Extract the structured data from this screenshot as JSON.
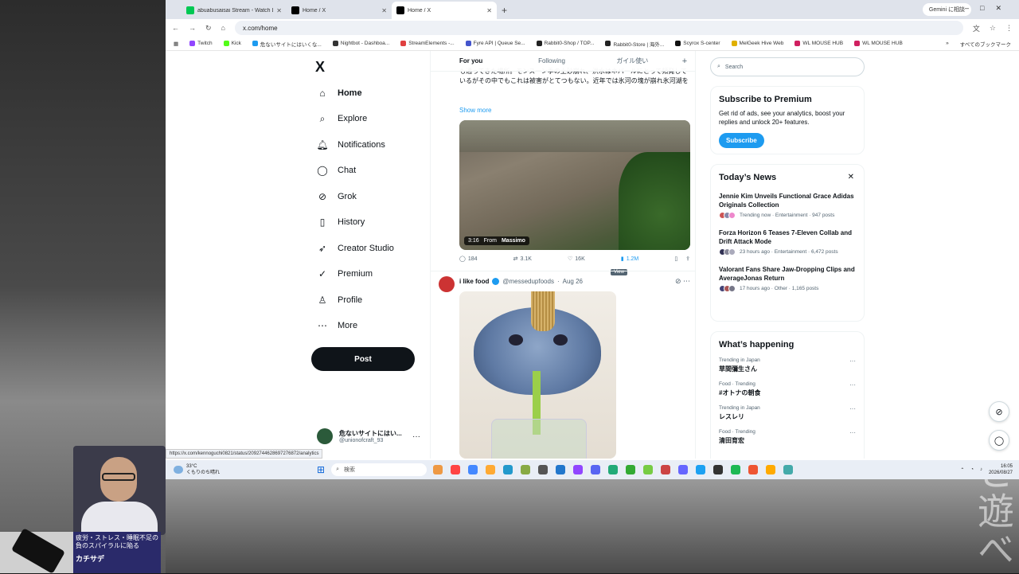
{
  "browser": {
    "tabs": [
      {
        "title": "abuabusaisai Stream - Watch L",
        "color": "#00c853"
      },
      {
        "title": "Home / X",
        "color": "#000000"
      },
      {
        "title": "Home / X",
        "color": "#000000"
      }
    ],
    "new_tab": "+",
    "gemini_button": "Gemini に相談",
    "url": "x.com/home",
    "bookmarks": [
      {
        "label": "Twitch",
        "color": "#9146ff"
      },
      {
        "label": "Kick",
        "color": "#53fc18"
      },
      {
        "label": "危ないサイトにはいくな...",
        "color": "#1d9bf0"
      },
      {
        "label": "Nightbot - Dashboa...",
        "color": "#333333"
      },
      {
        "label": "StreamElements -...",
        "color": "#e04040"
      },
      {
        "label": "Fyre API | Queue Se...",
        "color": "#4455cc"
      },
      {
        "label": "Rabbit0-Shop / TOP...",
        "color": "#222222"
      },
      {
        "label": "Rabbit0-Store | 海外...",
        "color": "#222222"
      },
      {
        "label": "Scyrox S-center",
        "color": "#111111"
      },
      {
        "label": "MelGeek Hive Web",
        "color": "#e0b000"
      },
      {
        "label": "WL MOUSE HUB",
        "color": "#d02060"
      },
      {
        "label": "WL MOUSE HUB",
        "color": "#d02060"
      }
    ],
    "bookmarks_more": "»",
    "all_bookmarks": "すべてのブックマーク",
    "status_url": "https://x.com/kennoguchi0821/status/2092744628697276872/analytics"
  },
  "nav": {
    "logo": "X",
    "items": [
      {
        "label": "Home",
        "icon": "home-icon",
        "glyph": "⌂"
      },
      {
        "label": "Explore",
        "icon": "search-icon",
        "glyph": "⌕"
      },
      {
        "label": "Notifications",
        "icon": "bell-icon",
        "glyph": "🔔︎"
      },
      {
        "label": "Chat",
        "icon": "chat-icon",
        "glyph": "◯"
      },
      {
        "label": "Grok",
        "icon": "grok-icon",
        "glyph": "⊘"
      },
      {
        "label": "History",
        "icon": "bookmark-icon",
        "glyph": "▯"
      },
      {
        "label": "Creator Studio",
        "icon": "rocket-icon",
        "glyph": "➶"
      },
      {
        "label": "Premium",
        "icon": "premium-icon",
        "glyph": "✓"
      },
      {
        "label": "Profile",
        "icon": "person-icon",
        "glyph": "♙"
      },
      {
        "label": "More",
        "icon": "more-circle-icon",
        "glyph": "⋯"
      }
    ],
    "post_button": "Post",
    "account": {
      "name": "危ないサイトにはい...",
      "handle": "@unionofcraft_93",
      "more": "···"
    }
  },
  "feed": {
    "tabs": [
      "For you",
      "Following",
      "ガイル使い"
    ],
    "add_tab": "+",
    "tweet1": {
      "text": "も通ってきた場所。モンスーン季の土砂崩れ、洪水はネパールにとって頻発しているがその中でもこれは被害がとてつもない。近年では氷河の塊が崩れ氷河湖を",
      "show_more": "Show more",
      "video_time": "3:16",
      "video_from": "From",
      "video_source": "Massimo",
      "replies": "184",
      "reposts": "3.1K",
      "likes": "16K",
      "views": "1.2M",
      "view_tooltip": "View"
    },
    "tweet2": {
      "name": "i like food",
      "handle": "@messedupfoods",
      "date": "Aug 26"
    }
  },
  "sidebar": {
    "search_placeholder": "Search",
    "premium": {
      "title": "Subscribe to Premium",
      "body": "Get rid of ads, see your analytics, boost your replies and unlock 20+ features.",
      "button": "Subscribe"
    },
    "news": {
      "title": "Today’s News",
      "close": "✕",
      "items": [
        {
          "title": "Jennie Kim Unveils Functional Grace Adidas Originals Collection",
          "meta": "Trending now · Entertainment · 947 posts"
        },
        {
          "title": "Forza Horizon 6 Teases 7-Eleven Collab and Drift Attack Mode",
          "meta": "23 hours ago · Entertainment · 6,472 posts"
        },
        {
          "title": "Valorant Fans Share Jaw-Dropping Clips and AverageJonas Return",
          "meta": "17 hours ago · Other · 1,165 posts"
        }
      ]
    },
    "happening": {
      "title": "What’s happening",
      "items": [
        {
          "context": "Trending in Japan",
          "topic": "草間彌生さん"
        },
        {
          "context": "Food · Trending",
          "topic": "#オトナの朝食"
        },
        {
          "context": "Trending in Japan",
          "topic": "レスレリ"
        },
        {
          "context": "Food · Trending",
          "topic": "清田育宏"
        }
      ]
    }
  },
  "taskbar": {
    "temp": "33°C",
    "weather": "くもりのち晴れ",
    "search": "検索",
    "time": "16:05",
    "date": "2026/08/27"
  },
  "overlay": {
    "banner_line1": "疲労・ストレス・睡眠不足の",
    "banner_line2": "負のスパイラルに陥る",
    "banner_brand": "カチサデ",
    "watermark": "危と遊べ"
  }
}
